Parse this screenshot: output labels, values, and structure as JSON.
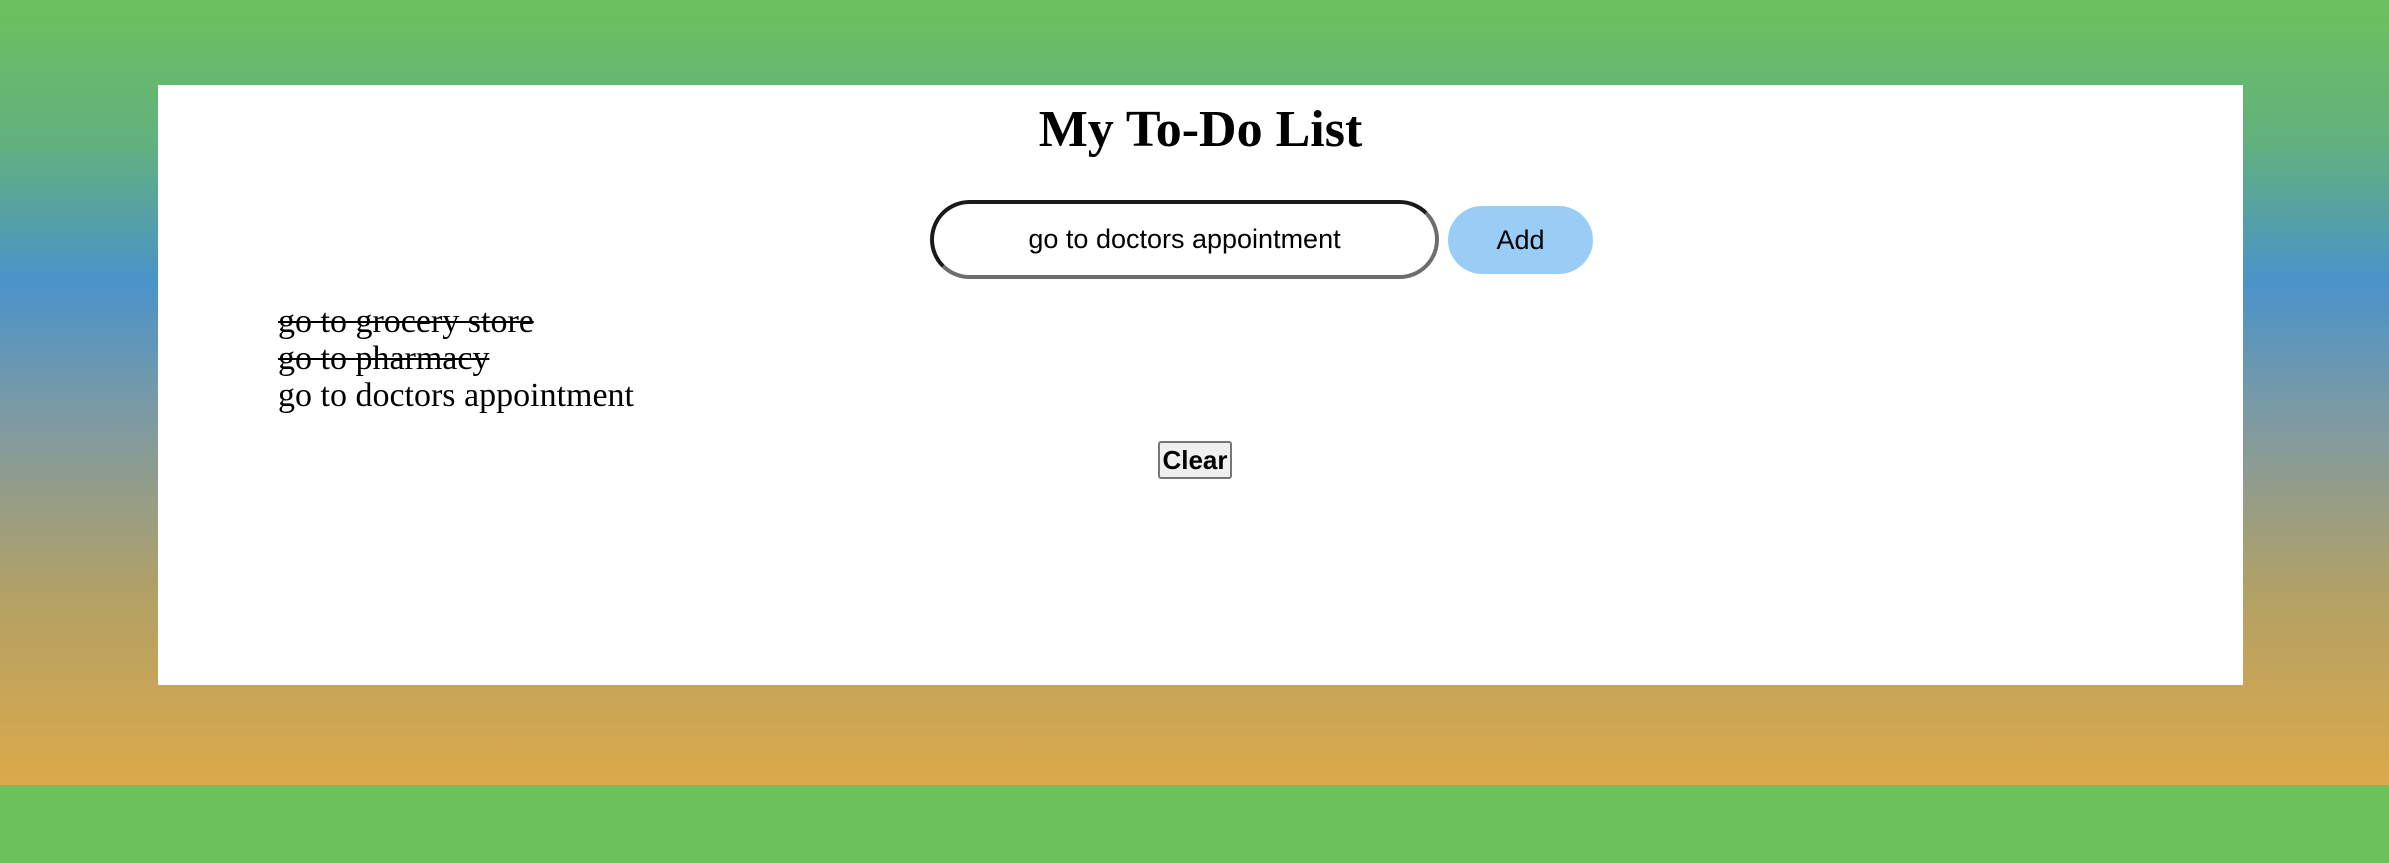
{
  "page": {
    "title": "My To-Do List"
  },
  "input": {
    "value": "go to doctors appointment",
    "placeholder": ""
  },
  "add_button": {
    "label": "Add"
  },
  "todos": [
    {
      "text": "go to grocery store",
      "completed": true
    },
    {
      "text": "go to pharmacy",
      "completed": true
    },
    {
      "text": "go to doctors appointment",
      "completed": false
    }
  ],
  "clear_button": {
    "label": "Clear"
  },
  "colors": {
    "background": "#6cc15d",
    "gradient": [
      "#6cc15d",
      "#4a93c9",
      "#dca94a"
    ],
    "card": "#ffffff",
    "add_button": "#9acdf5"
  }
}
